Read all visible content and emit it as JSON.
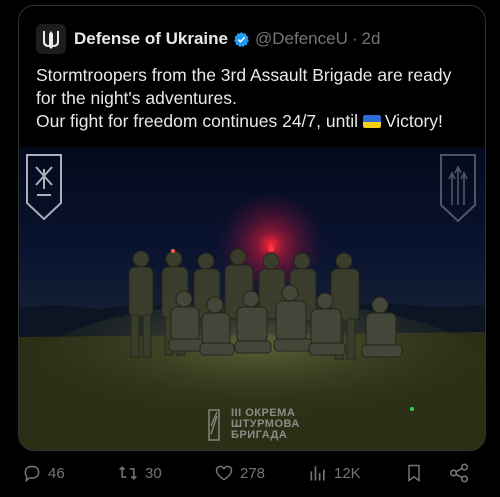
{
  "tweet": {
    "author_name": "Defense of Ukraine",
    "handle": "@DefenceU",
    "separator": "·",
    "time": "2d",
    "text_line1": "Stormtroopers from the 3rd Assault Brigade are ready",
    "text_line2": "for the night's adventures.",
    "text_line3_before_flag": "Our fight for freedom continues 24/7, until",
    "text_line3_after_flag": "Victory!",
    "flag_colors": {
      "top": "#2d6ed6",
      "bottom": "#f5cf1a"
    }
  },
  "photo": {
    "watermark_lines": [
      "ІІІ ОКРЕМА",
      "ШТУРМОВА",
      "БРИГАДА"
    ],
    "emblem_icon": "brigade-emblem-icon"
  },
  "actions": {
    "replies": "46",
    "reposts": "30",
    "likes": "278",
    "views": "12K"
  },
  "colors": {
    "accent_verified": "#1d9bf0",
    "muted": "#71767b",
    "text": "#e7e9ea"
  }
}
